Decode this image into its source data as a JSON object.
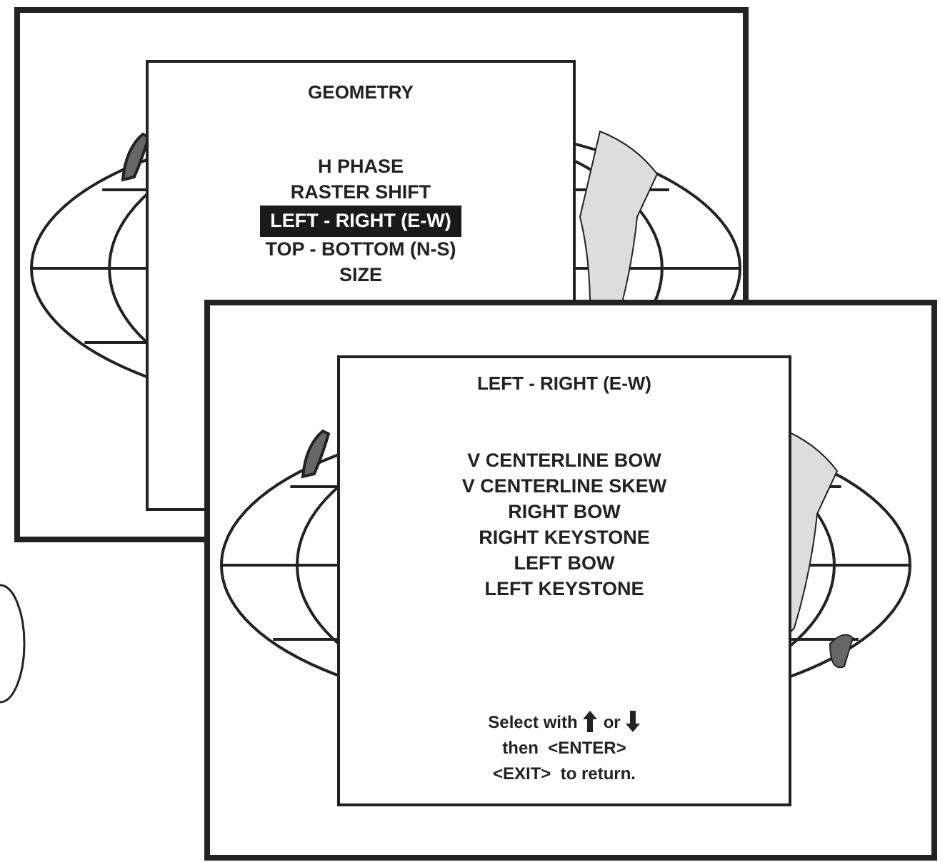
{
  "screens": [
    {
      "title": "GEOMETRY",
      "items": [
        {
          "label": "H PHASE",
          "selected": false
        },
        {
          "label": "RASTER SHIFT",
          "selected": false
        },
        {
          "label": "LEFT - RIGHT (E-W)",
          "selected": true
        },
        {
          "label": "TOP - BOTTOM (N-S)",
          "selected": false
        },
        {
          "label": "SIZE",
          "selected": false
        }
      ]
    },
    {
      "title": "LEFT - RIGHT (E-W)",
      "items": [
        {
          "label": "V CENTERLINE BOW",
          "selected": false
        },
        {
          "label": "V CENTERLINE SKEW",
          "selected": false
        },
        {
          "label": "RIGHT BOW",
          "selected": false
        },
        {
          "label": "RIGHT KEYSTONE",
          "selected": false
        },
        {
          "label": "LEFT BOW",
          "selected": false
        },
        {
          "label": "LEFT KEYSTONE",
          "selected": false
        }
      ],
      "hint": {
        "select": "Select with",
        "or": "or",
        "enter_line": "then  <ENTER>",
        "exit_line": "<EXIT>  to return."
      }
    }
  ]
}
